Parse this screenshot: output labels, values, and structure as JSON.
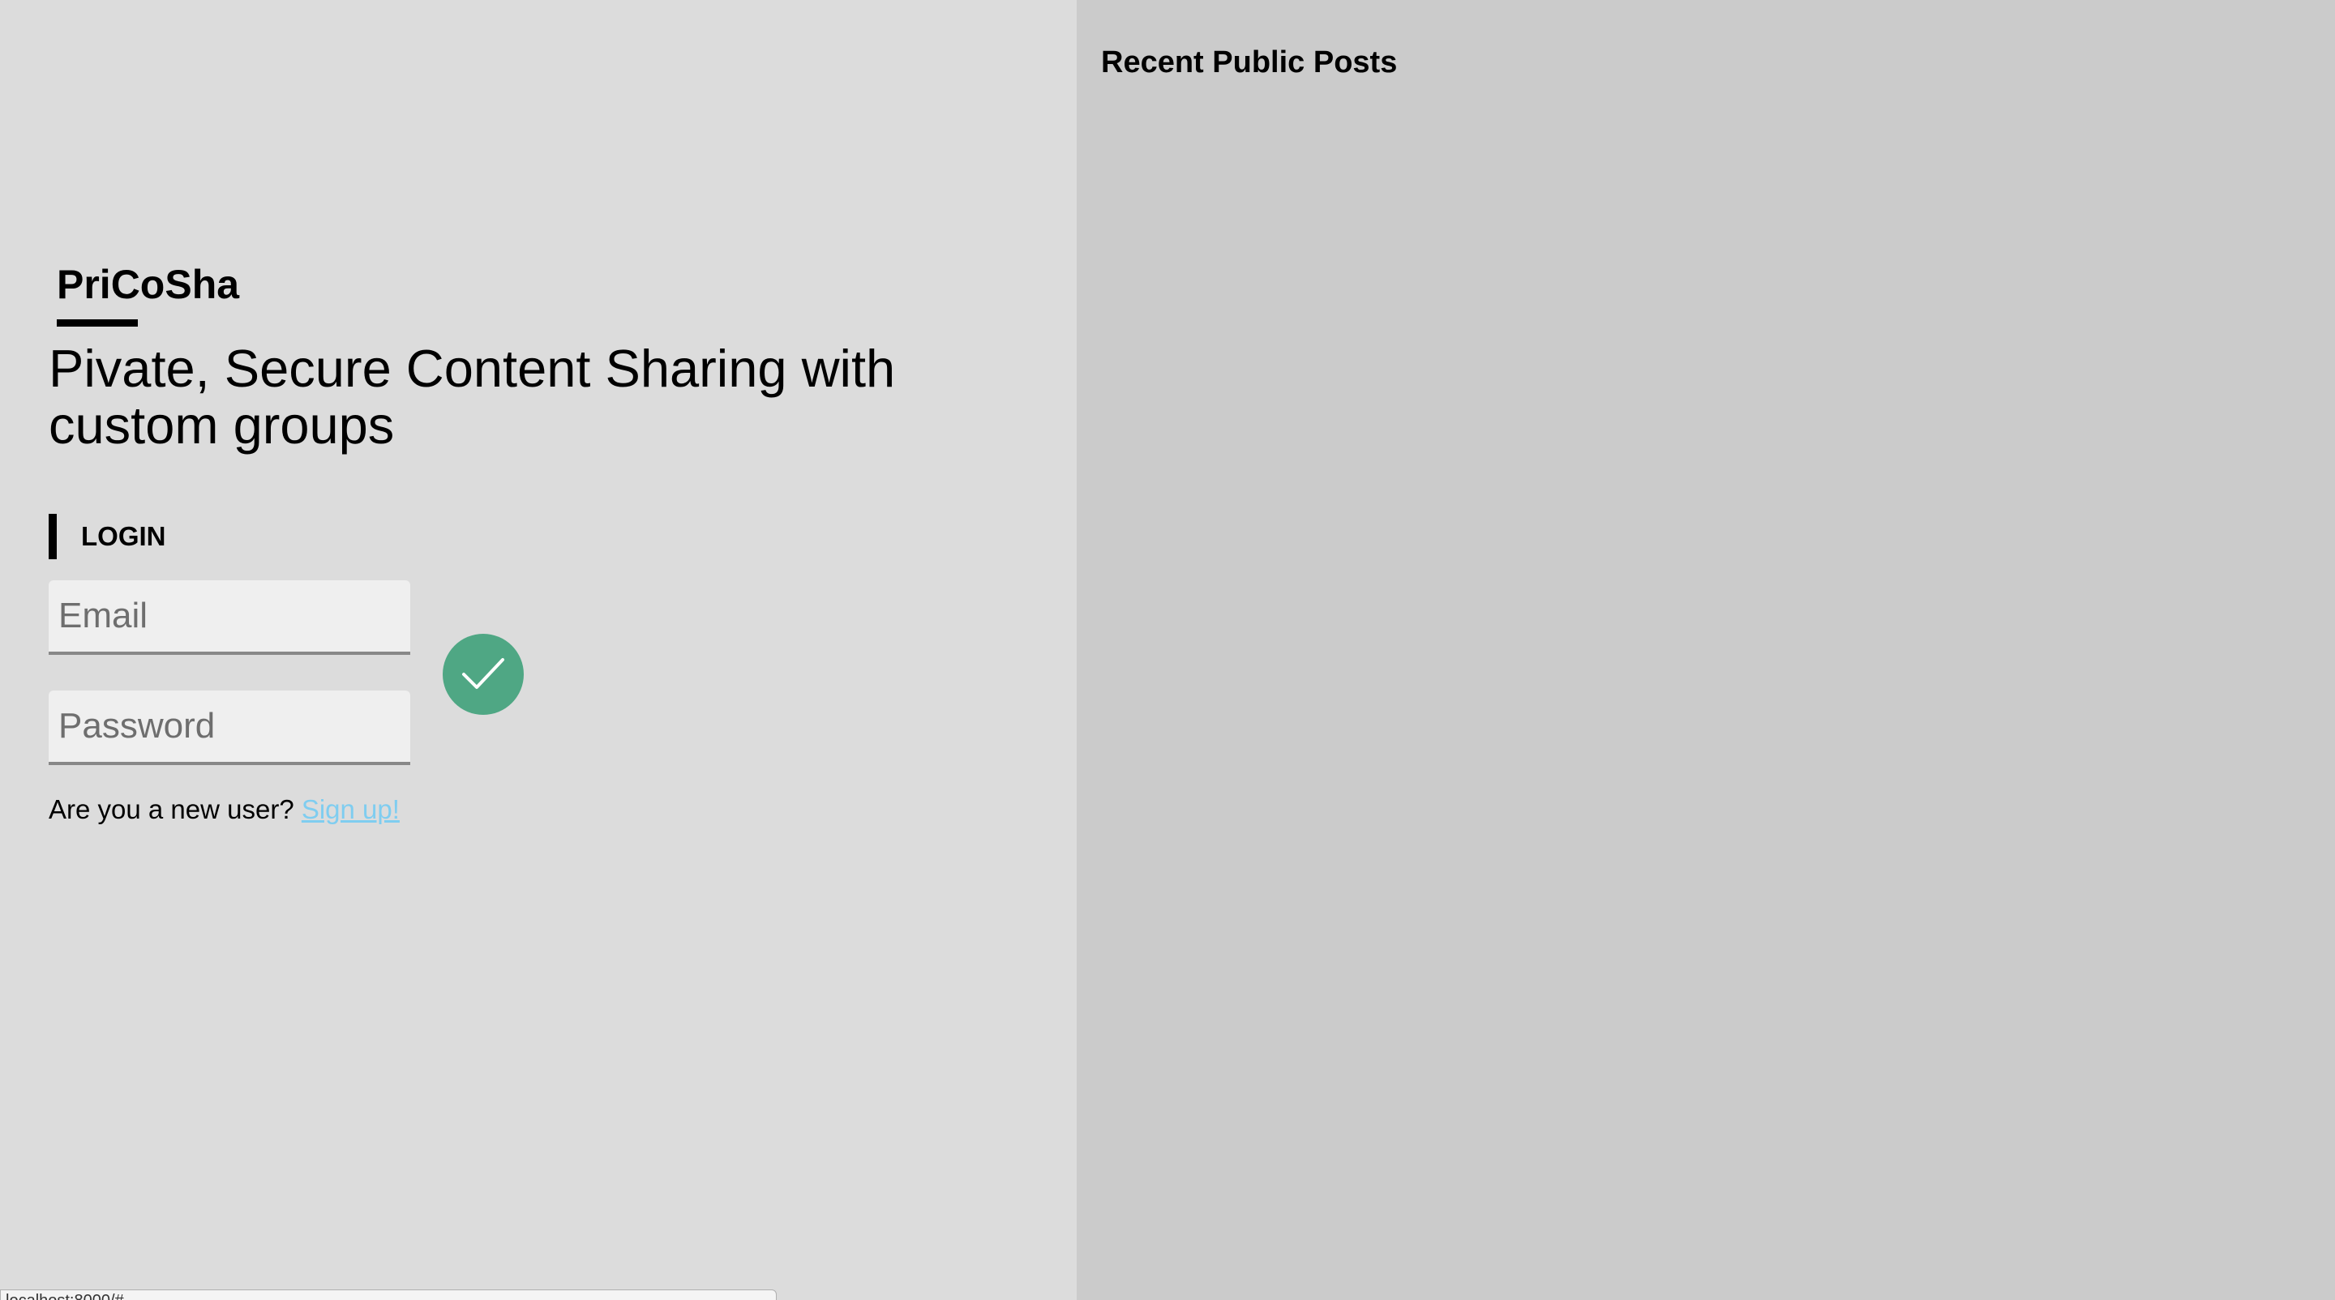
{
  "brand": {
    "name": "PriCoSha",
    "tagline": "Pivate, Secure Content Sharing with custom groups"
  },
  "login": {
    "heading": "LOGIN",
    "email_placeholder": "Email",
    "password_placeholder": "Password",
    "submit_icon": "checkmark-icon",
    "submit_color": "#4fa784",
    "new_user_prompt": "Are you a new user?",
    "signup_link_text": "Sign up!"
  },
  "posts": {
    "heading": "Recent Public Posts",
    "items": []
  },
  "status_bar": {
    "url": "localhost:8000/#"
  },
  "colors": {
    "left_background": "#dcdcdc",
    "right_background": "#cbcbcb",
    "link": "#7fcdf0"
  }
}
